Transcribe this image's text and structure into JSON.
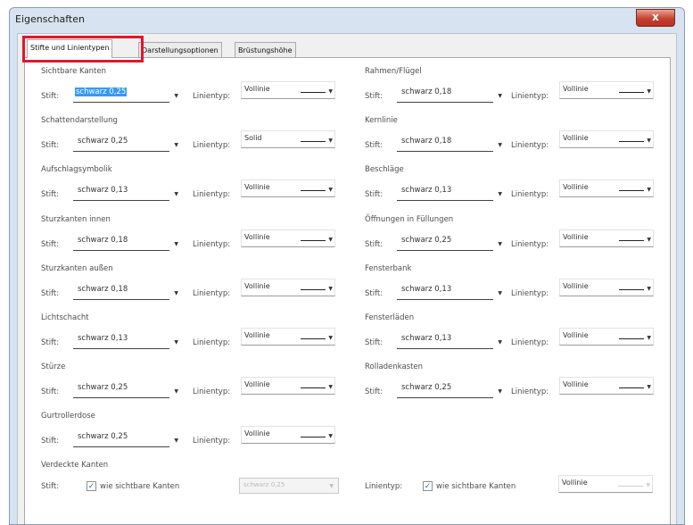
{
  "window": {
    "title": "Eigenschaften",
    "close_label": "x"
  },
  "tabs": [
    "Stifte und Linientypen",
    "Darstellungsoptionen",
    "Brüstungshöhe"
  ],
  "labels": {
    "pen": "Stift:",
    "linetype": "Linientyp:"
  },
  "left_column": [
    {
      "header": "Sichtbare Kanten",
      "pen": "schwarz 0,25",
      "linetype": "Vollinie"
    },
    {
      "header": "Schattendarstellung",
      "pen": "schwarz 0,25",
      "linetype": "Solid"
    },
    {
      "header": "Aufschlagsymbolik",
      "pen": "schwarz 0,13",
      "linetype": "Vollinie"
    },
    {
      "header": "Sturzkanten innen",
      "pen": "schwarz 0,18",
      "linetype": "Vollinie"
    },
    {
      "header": "Sturzkanten außen",
      "pen": "schwarz 0,18",
      "linetype": "Vollinie"
    },
    {
      "header": "Lichtschacht",
      "pen": "schwarz 0,13",
      "linetype": "Vollinie"
    },
    {
      "header": "Stürze",
      "pen": "schwarz 0,25",
      "linetype": "Vollinie"
    },
    {
      "header": "Gurtrollerdose",
      "pen": "schwarz 0,25",
      "linetype": "Vollinie"
    }
  ],
  "right_column": [
    {
      "header": "Rahmen/Flügel",
      "pen": "schwarz 0,18",
      "linetype": "Vollinie"
    },
    {
      "header": "Kernlinie",
      "pen": "schwarz 0,18",
      "linetype": "Vollinie"
    },
    {
      "header": "Beschläge",
      "pen": "schwarz 0,13",
      "linetype": "Vollinie"
    },
    {
      "header": "Öffnungen in Füllungen",
      "pen": "schwarz 0,25",
      "linetype": "Vollinie"
    },
    {
      "header": "Fensterbank",
      "pen": "schwarz 0,13",
      "linetype": "Vollinie"
    },
    {
      "header": "Fensterläden",
      "pen": "schwarz 0,13",
      "linetype": "Vollinie"
    },
    {
      "header": "Rolladenkasten",
      "pen": "schwarz 0,25",
      "linetype": "Vollinie"
    }
  ],
  "hidden_edges": {
    "header": "Verdeckte Kanten",
    "pen_checkbox_label": "wie sichtbare Kanten",
    "pen_disabled_value": "schwarz 0,25",
    "linetype_checkbox_label": "wie sichtbare Kanten",
    "linetype_value": "Vollinie"
  },
  "colors": {
    "tab_highlight": "#e2162c",
    "selection": "#3399ff",
    "close_button": "#c4412f"
  }
}
